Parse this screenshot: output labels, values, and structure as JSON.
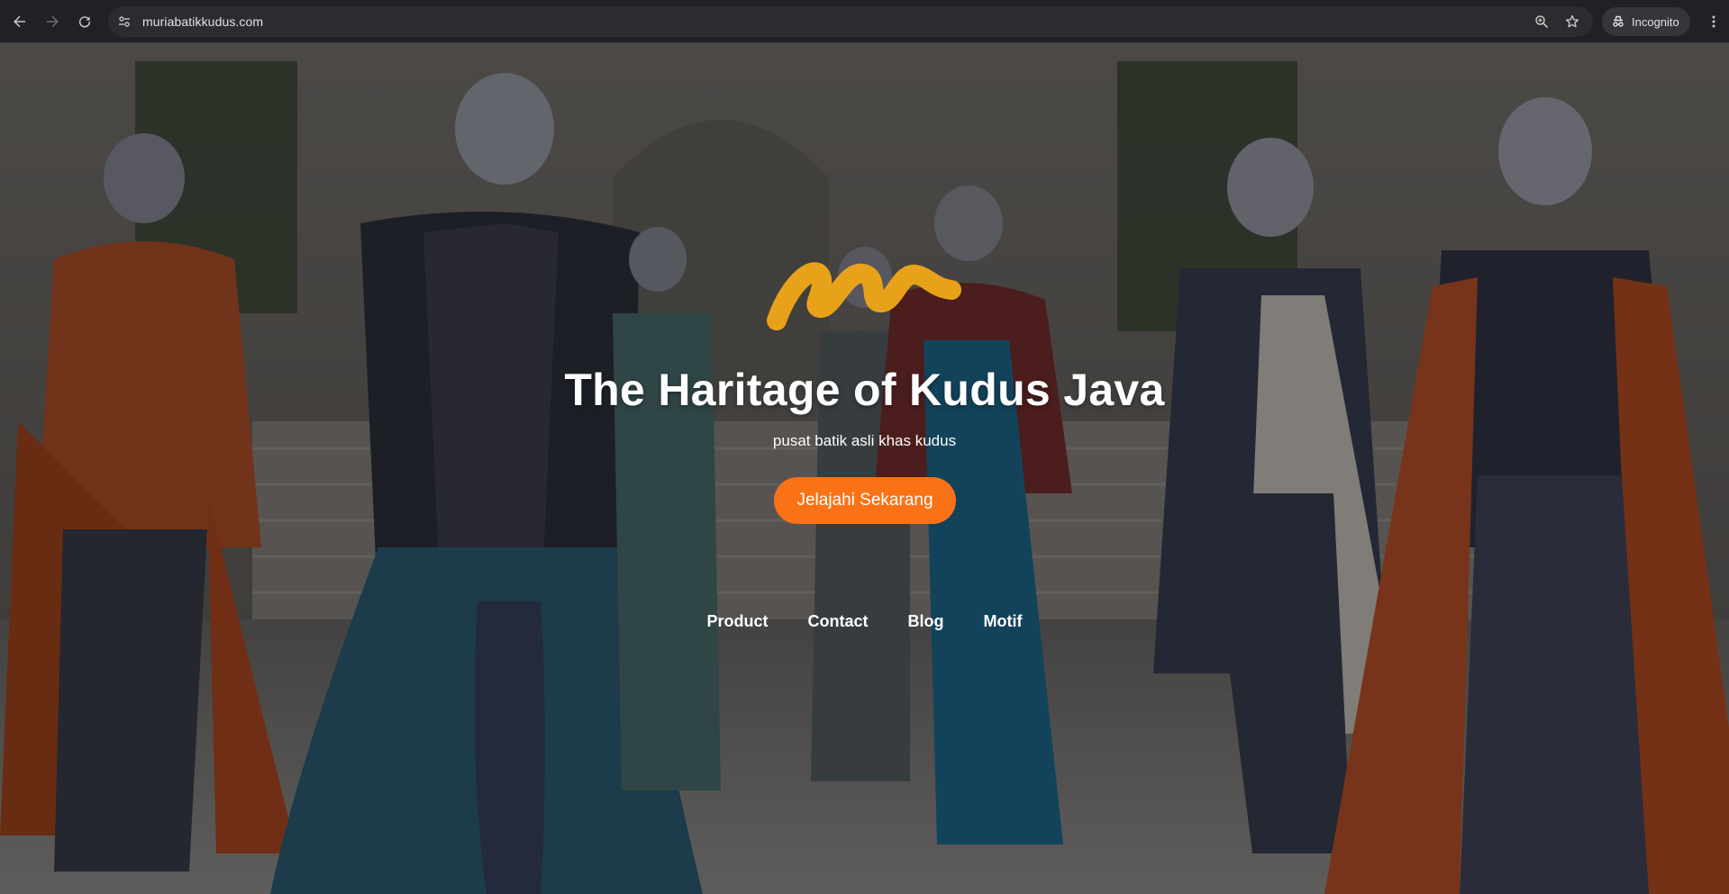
{
  "browser": {
    "url": "muriabatikkudus.com",
    "incognito_label": "Incognito",
    "icons": {
      "back": "arrow-left-icon",
      "forward": "arrow-right-icon",
      "reload": "reload-icon",
      "site_info": "tune-icon",
      "zoom": "zoom-icon",
      "bookmark": "star-icon",
      "incognito": "incognito-icon",
      "menu": "kebab-menu-icon"
    }
  },
  "hero": {
    "logo": "m-brush-logo",
    "title": "The Haritage of Kudus Java",
    "subtitle": "pusat batik asli khas kudus",
    "cta_label": "Jelajahi Sekarang"
  },
  "nav": {
    "items": [
      {
        "label": "Product"
      },
      {
        "label": "Contact"
      },
      {
        "label": "Blog"
      },
      {
        "label": "Motif"
      }
    ]
  },
  "colors": {
    "accent": "#f97316",
    "logo": "#e8a21a",
    "chrome_bg": "#202124",
    "omnibox_bg": "#2b2c2f"
  }
}
